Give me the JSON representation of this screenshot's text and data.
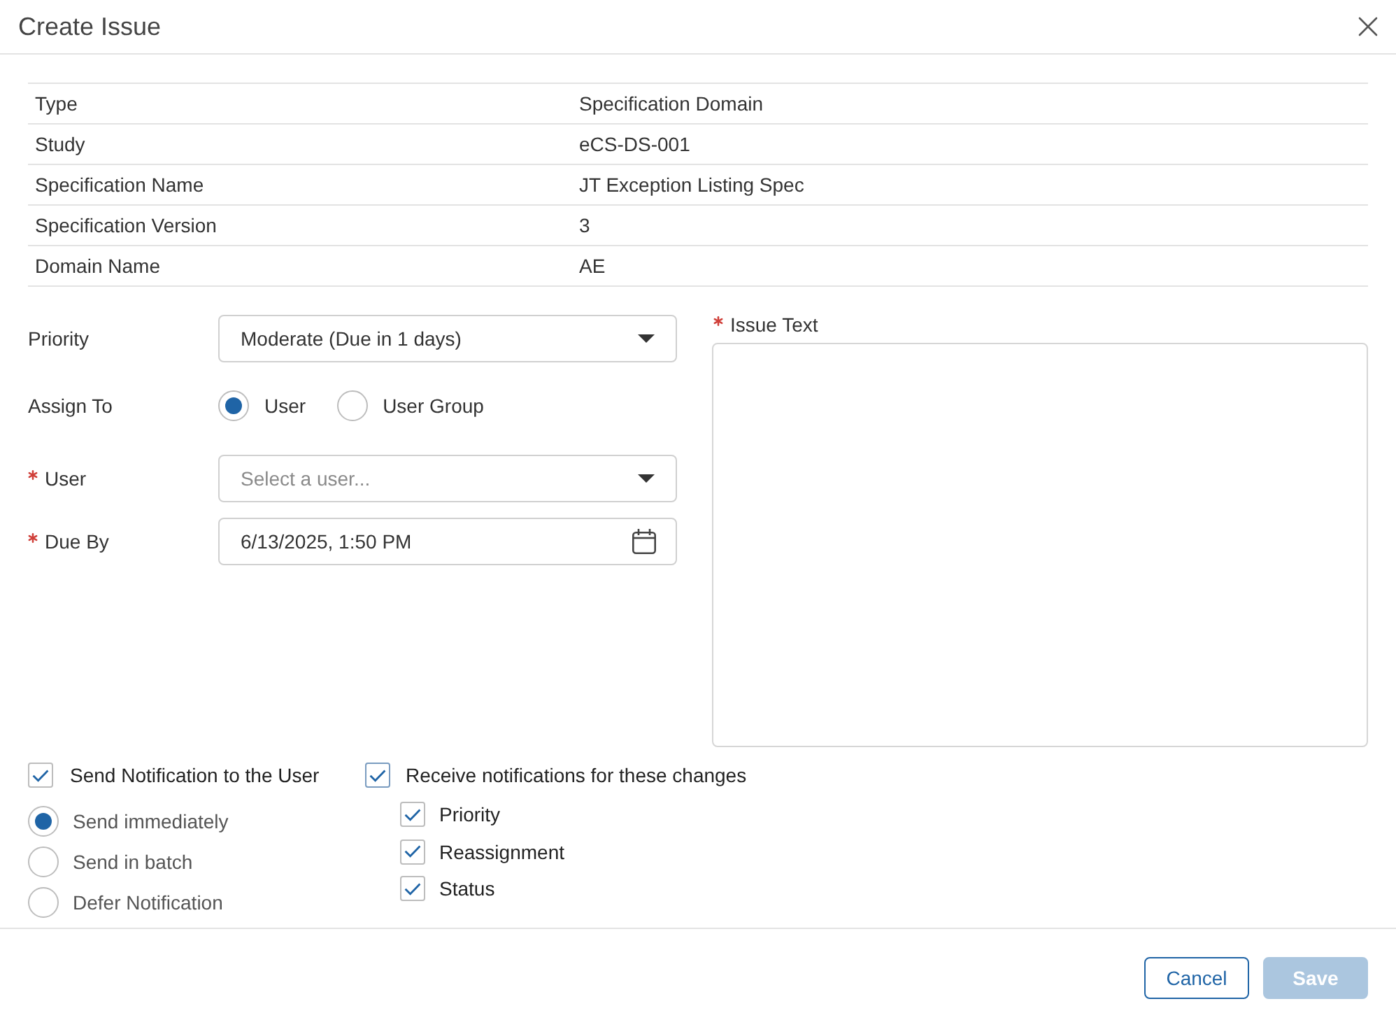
{
  "window": {
    "title": "Create Issue"
  },
  "details": [
    {
      "label": "Type",
      "value": "Specification Domain"
    },
    {
      "label": "Study",
      "value": "eCS-DS-001"
    },
    {
      "label": "Specification Name",
      "value": "JT Exception Listing Spec"
    },
    {
      "label": "Specification Version",
      "value": "3"
    },
    {
      "label": "Domain Name",
      "value": "AE"
    }
  ],
  "fields": [
    {
      "kind": "select",
      "label": "Priority",
      "required": false,
      "value": "Moderate (Due in 1 days)"
    },
    {
      "kind": "radio",
      "label": "Assign To",
      "required": false,
      "options": [
        {
          "label": "User",
          "selected": true
        },
        {
          "label": "User Group",
          "selected": false
        }
      ]
    },
    {
      "kind": "select",
      "label": "User",
      "required": true,
      "placeholder": "Select a user..."
    },
    {
      "kind": "date",
      "label": "Due By",
      "required": true,
      "value": "6/13/2025, 1:50 PM"
    }
  ],
  "issue_text": {
    "label": "Issue Text",
    "required": true
  },
  "notification": {
    "label": "Send Notification to the User",
    "checked": true,
    "options": [
      {
        "label": "Send immediately",
        "selected": true
      },
      {
        "label": "Send in batch",
        "selected": false
      },
      {
        "label": "Defer Notification",
        "selected": false
      }
    ]
  },
  "watch": {
    "label": "Receive notifications for these changes",
    "checked": true,
    "items": [
      {
        "label": "Priority",
        "checked": true
      },
      {
        "label": "Reassignment",
        "checked": true
      },
      {
        "label": "Status",
        "checked": true
      }
    ]
  },
  "buttons": [
    {
      "kind": "secondary",
      "label": "Cancel",
      "disabled": false
    },
    {
      "kind": "primary",
      "label": "Save",
      "disabled": true
    }
  ]
}
